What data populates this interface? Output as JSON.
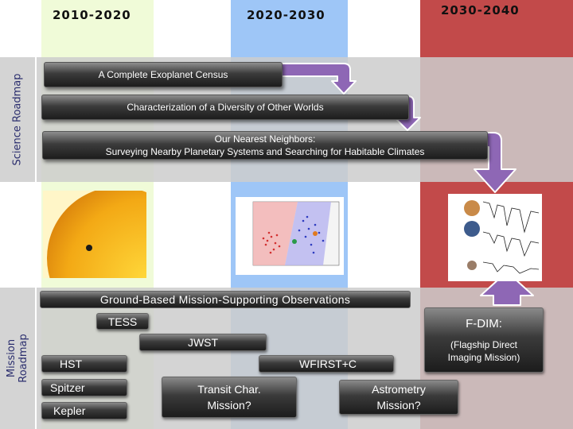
{
  "decades": [
    "2010-2020",
    "2020-2030",
    "2030-2040"
  ],
  "sections": {
    "science": "Science Roadmap",
    "mission_line1": "Mission",
    "mission_line2": "Roadmap"
  },
  "science_goals": {
    "census": "A Complete Exoplanet Census",
    "characterization": "Characterization of a Diversity of Other Worlds",
    "neighbors_line1": "Our Nearest Neighbors:",
    "neighbors_line2": "Surveying Nearby Planetary Systems and Searching for Habitable Climates"
  },
  "ground": "Ground-Based Mission-Supporting Observations",
  "missions": {
    "tess": "TESS",
    "jwst": "JWST",
    "hst": "HST",
    "wfirst": "WFIRST+C",
    "spitzer": "Spitzer",
    "kepler": "Kepler",
    "transit_line1": "Transit Char.",
    "transit_line2": "Mission?",
    "astro_line1": "Astrometry",
    "astro_line2": "Mission?",
    "fdim_line1": "F-DIM:",
    "fdim_line2": "(Flagship Direct",
    "fdim_line3": "Imaging Mission)"
  },
  "colors": {
    "col_2010": "#f0fbd8",
    "col_2020": "#9ec6f7",
    "col_2030": "#c24a4a",
    "arrow": "#8e67b5",
    "bar_dark": "#1c1c1c"
  }
}
